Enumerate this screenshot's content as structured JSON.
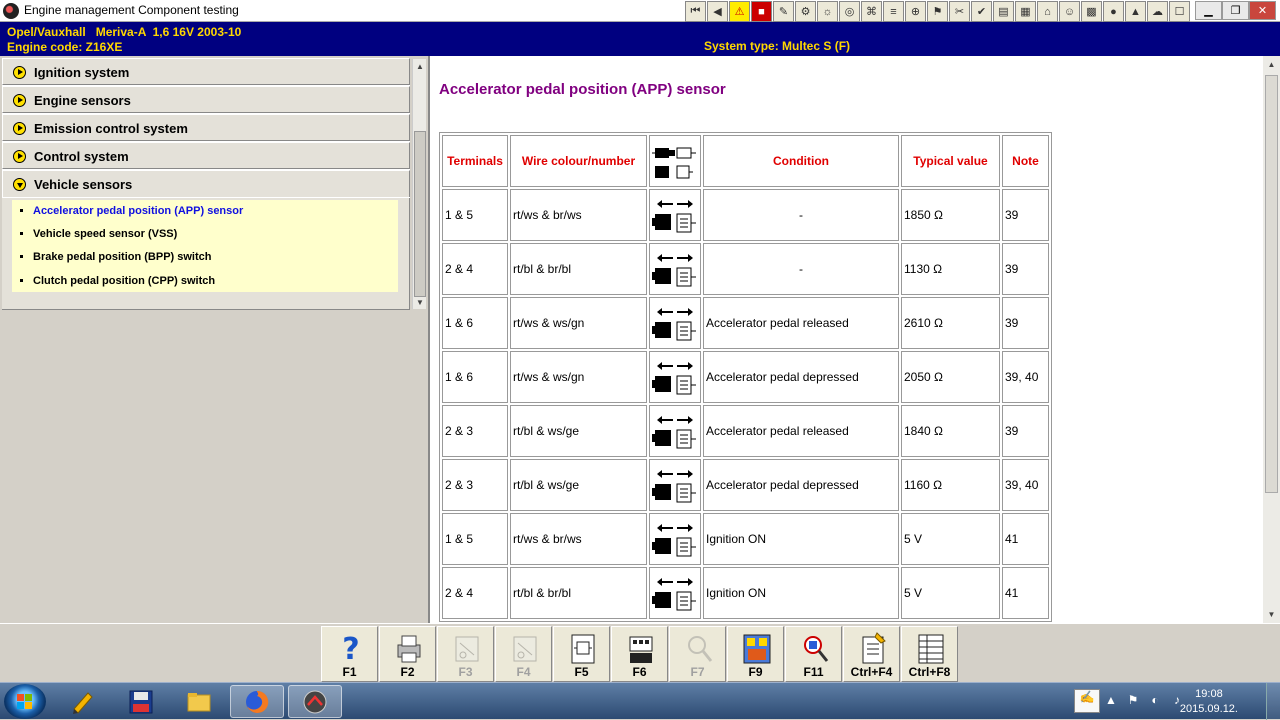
{
  "window": {
    "title": "Engine management Component testing"
  },
  "vehicle": {
    "make_model": "Opel/Vauxhall   Meriva-A  1,6 16V 2003-10",
    "engine_code": "Engine code: Z16XE",
    "system_type": "System type: Multec S (F)"
  },
  "menu": {
    "sections": [
      {
        "label": "Ignition system",
        "expanded": false
      },
      {
        "label": "Engine sensors",
        "expanded": false
      },
      {
        "label": "Emission control system",
        "expanded": false
      },
      {
        "label": "Control system",
        "expanded": false
      },
      {
        "label": "Vehicle sensors",
        "expanded": true
      }
    ],
    "sub_items": [
      {
        "label": "Accelerator pedal position (APP) sensor",
        "active": true
      },
      {
        "label": "Vehicle speed sensor (VSS)",
        "active": false
      },
      {
        "label": "Brake pedal position (BPP) switch",
        "active": false
      },
      {
        "label": "Clutch pedal position (CPP) switch",
        "active": false
      }
    ]
  },
  "content": {
    "heading": "Accelerator pedal position (APP) sensor",
    "table": {
      "headers": [
        "Terminals",
        "Wire colour/number",
        "",
        "Condition",
        "Typical value",
        "Note"
      ],
      "rows": [
        {
          "terminals": "1 & 5",
          "wire": "rt/ws & br/ws",
          "condition": "-",
          "value": "1850 Ω",
          "note": "39"
        },
        {
          "terminals": "2 & 4",
          "wire": "rt/bl & br/bl",
          "condition": "-",
          "value": "1130 Ω",
          "note": "39"
        },
        {
          "terminals": "1 & 6",
          "wire": "rt/ws & ws/gn",
          "condition": "Accelerator pedal released",
          "value": "2610 Ω",
          "note": "39"
        },
        {
          "terminals": "1 & 6",
          "wire": "rt/ws & ws/gn",
          "condition": "Accelerator pedal depressed",
          "value": "2050 Ω",
          "note": "39, 40"
        },
        {
          "terminals": "2 & 3",
          "wire": "rt/bl & ws/ge",
          "condition": "Accelerator pedal released",
          "value": "1840 Ω",
          "note": "39"
        },
        {
          "terminals": "2 & 3",
          "wire": "rt/bl & ws/ge",
          "condition": "Accelerator pedal depressed",
          "value": "1160 Ω",
          "note": "39, 40"
        },
        {
          "terminals": "1 & 5",
          "wire": "rt/ws & br/ws",
          "condition": "Ignition ON",
          "value": "5 V",
          "note": "41"
        },
        {
          "terminals": "2 & 4",
          "wire": "rt/bl & br/bl",
          "condition": "Ignition ON",
          "value": "5 V",
          "note": "41"
        }
      ]
    }
  },
  "function_keys": [
    {
      "label": "F1",
      "enabled": true,
      "icon": "help-icon"
    },
    {
      "label": "F2",
      "enabled": true,
      "icon": "printer-icon"
    },
    {
      "label": "F3",
      "enabled": false,
      "icon": "diagram-icon"
    },
    {
      "label": "F4",
      "enabled": false,
      "icon": "diagram-icon"
    },
    {
      "label": "F5",
      "enabled": true,
      "icon": "component-icon"
    },
    {
      "label": "F6",
      "enabled": true,
      "icon": "connector-icon"
    },
    {
      "label": "F7",
      "enabled": false,
      "icon": "probe-icon"
    },
    {
      "label": "F9",
      "enabled": true,
      "icon": "pinout-icon"
    },
    {
      "label": "F11",
      "enabled": true,
      "icon": "magnifier-icon"
    },
    {
      "label": "Ctrl+F4",
      "enabled": true,
      "icon": "notes-icon"
    },
    {
      "label": "Ctrl+F8",
      "enabled": true,
      "icon": "table-icon"
    }
  ],
  "taskbar": {
    "time": "19:08",
    "date": "2015.09.12."
  },
  "colors": {
    "info_bar_bg": "#000080",
    "info_bar_text": "#ffd800",
    "heading": "#800080",
    "table_header": "#e00000",
    "active_sub_item": "#1010e0"
  }
}
